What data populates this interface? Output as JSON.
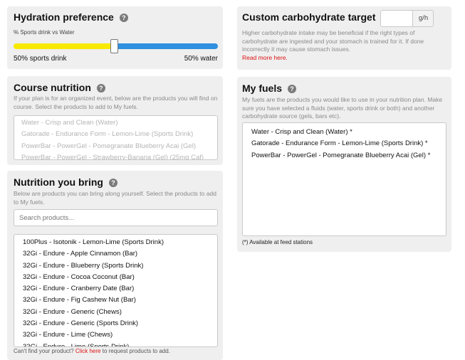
{
  "hydration": {
    "title": "Hydration preference",
    "help_icon": "question-circle-icon",
    "slider_label": "% Sports drink vs Water",
    "sports_pct": 0.5,
    "left_label": "50% sports drink",
    "right_label": "50% water",
    "colors": {
      "sports": "#f7ea00",
      "water": "#2f8fe0"
    }
  },
  "carb_target": {
    "title": "Custom carbohydrate target",
    "help_icon": "question-circle-icon",
    "input_value": "",
    "unit": "g/h",
    "description": "Higher carbohydrate intake may be beneficial if the right types of carbohydrate are ingested and your stomach is trained for it. If done incorrectly it may cause stomach issues.",
    "read_more": "Read more here."
  },
  "course_nutrition": {
    "title": "Course nutrition",
    "help_icon": "question-circle-icon",
    "description": "If your plan is for an organized event, below are the products you will find on course. Select the products to add to My fuels.",
    "items": [
      "Water - Crisp and Clean (Water)",
      "Gatorade - Endurance Form - Lemon-Lime (Sports Drink)",
      "PowerBar - PowerGel - Pomegranate Blueberry Acai (Gel)",
      "PowerBar - PowerGel - Strawberry-Banana (Gel) (25mg Caf)"
    ]
  },
  "my_fuels": {
    "title": "My fuels",
    "help_icon": "question-circle-icon",
    "description": "My fuels are the products you would like to use in your nutrition plan. Make sure you have selected a fluids (water, sports drink or both) and another carbohydrate source (gels, bars etc).",
    "items": [
      "Water - Crisp and Clean (Water) *",
      "Gatorade - Endurance Form - Lemon-Lime (Sports Drink) *",
      "PowerBar - PowerGel - Pomegranate Blueberry Acai (Gel) *"
    ],
    "footnote": "(*) Available at feed stations"
  },
  "nutrition_bring": {
    "title": "Nutrition you bring",
    "help_icon": "question-circle-icon",
    "description": "Below are products you can bring along yourself. Select the products to add to My fuels.",
    "search_placeholder": "Search products...",
    "items": [
      "100Plus - Isotonik - Lemon-Lime (Sports Drink)",
      "32Gi - Endure - Apple Cinnamon (Bar)",
      "32Gi - Endure - Blueberry (Sports Drink)",
      "32Gi - Endure - Cocoa Coconut (Bar)",
      "32Gi - Endure - Cranberry Date (Bar)",
      "32Gi - Endure - Fig Cashew Nut (Bar)",
      "32Gi - Endure - Generic (Chews)",
      "32Gi - Endure - Generic (Sports Drink)",
      "32Gi - Endure - Lime (Chews)",
      "32Gi - Endure - Lime (Sports Drink)"
    ],
    "footer_prefix": "Can't find your product?",
    "footer_link": "Click here",
    "footer_suffix": "to request products to add."
  }
}
